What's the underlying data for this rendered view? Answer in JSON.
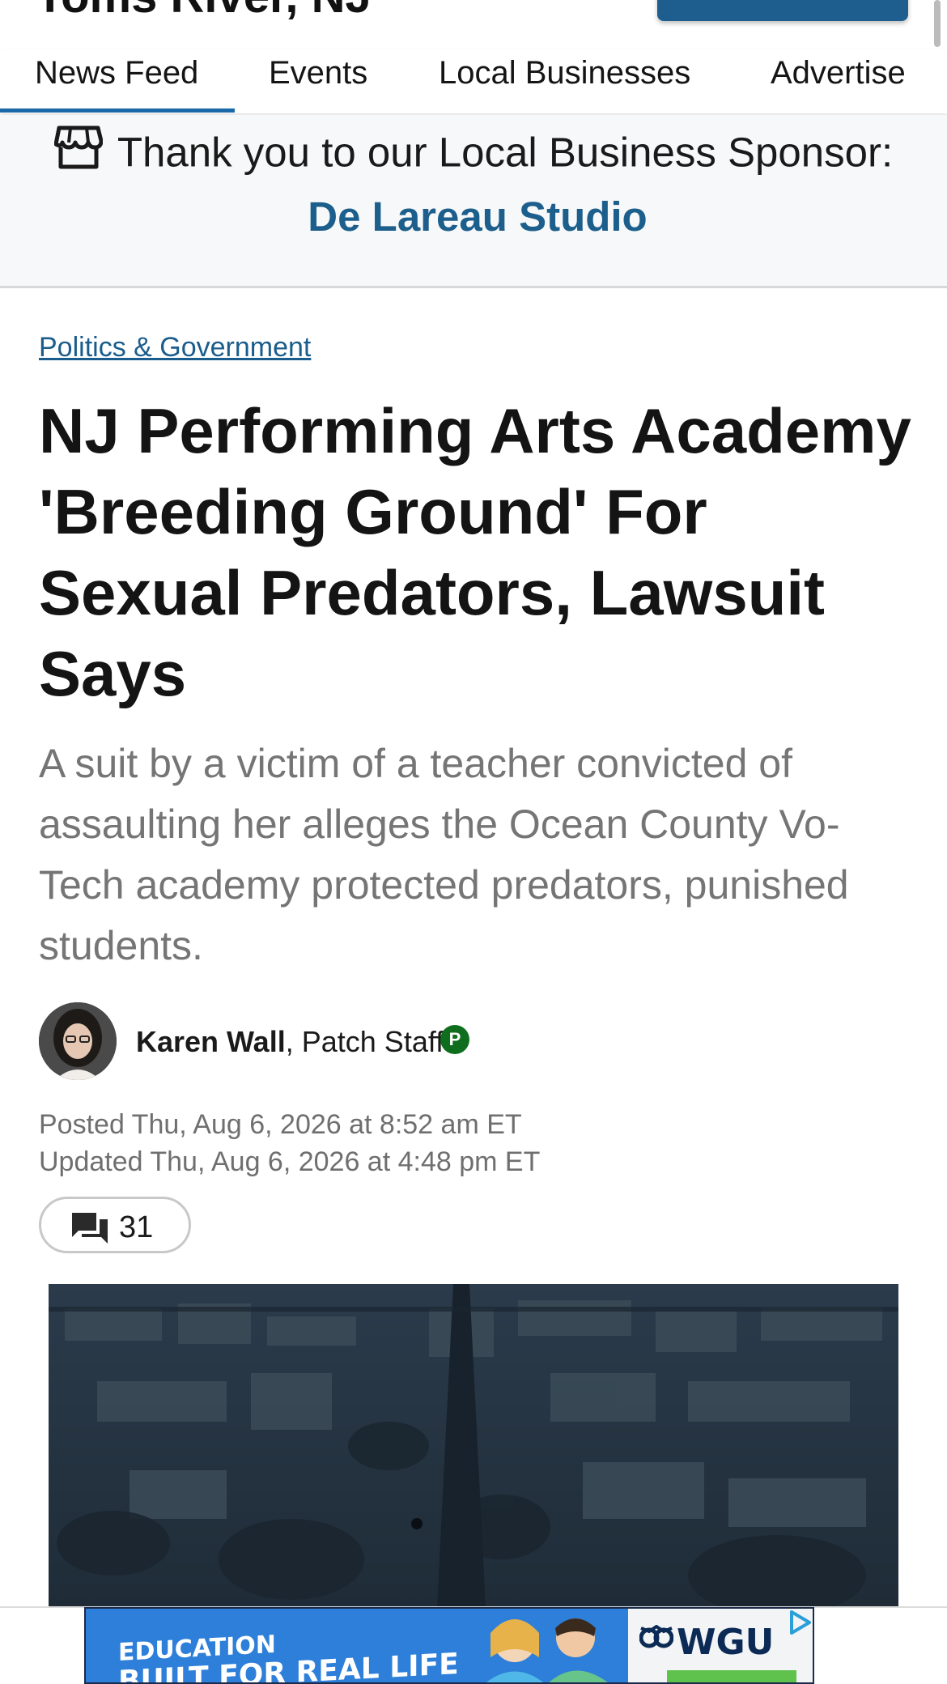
{
  "header": {
    "site_title": "Toms River, NJ"
  },
  "tabs": [
    {
      "label": "News Feed",
      "active": true
    },
    {
      "label": "Events",
      "active": false
    },
    {
      "label": "Local Businesses",
      "active": false
    },
    {
      "label": "Advertise",
      "active": false
    }
  ],
  "sponsor": {
    "prefix": "Thank you to our Local Business Sponsor:",
    "name": "De Lareau Studio",
    "icon": "storefront-icon"
  },
  "article": {
    "category": "Politics & Government",
    "headline": "NJ Performing Arts Academy 'Breeding Ground' For Sexual Predators, Lawsuit Says",
    "dek": "A suit by a victim of a teacher convicted of assaulting her alleges the Ocean County Vo-Tech academy protected predators, punished students.",
    "author": "Karen Wall",
    "author_separator": ",",
    "author_role": "Patch Staff",
    "badge": "P",
    "posted": "Posted Thu, Aug 6, 2026 at 8:52 am ET",
    "updated": "Updated Thu, Aug 6, 2026 at 4:48 pm ET",
    "comment_count": "31"
  },
  "ad": {
    "line1": "EDUCATION",
    "line2": "BUILT FOR REAL LIFE",
    "brand": "WGU"
  },
  "colors": {
    "accent": "#1a69a8",
    "link": "#1a5d8c",
    "badge_green": "#0f6e1d"
  }
}
